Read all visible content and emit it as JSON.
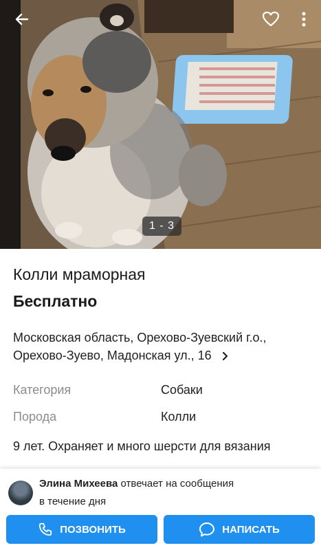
{
  "photo": {
    "counter": "1 - 3"
  },
  "icons": {
    "back": "arrow-left-icon",
    "favorite": "heart-outline-icon",
    "more": "more-vertical-icon",
    "chevron": "chevron-right-icon",
    "phone": "phone-icon",
    "chat": "chat-bubble-icon"
  },
  "listing": {
    "title": "Колли мраморная",
    "price": "Бесплатно",
    "address_line1": "Московская область, Орехово-Зуевский г.о.,",
    "address_line2": "Орехово-Зуево, Мадонская ул., 16"
  },
  "specs": [
    {
      "label": "Категория",
      "value": "Собаки"
    },
    {
      "label": "Порода",
      "value": "Колли"
    }
  ],
  "description": "9 лет. Охраняет и много шерсти для вязания",
  "seller": {
    "name": "Элина Михеева",
    "response_prefix": "отвечает на сообщения",
    "response_time": "в течение дня"
  },
  "actions": {
    "call_label": "ПОЗВОНИТЬ",
    "write_label": "НАПИСАТЬ"
  },
  "colors": {
    "accent": "#1f8ff0",
    "muted": "#8c8c8c"
  }
}
